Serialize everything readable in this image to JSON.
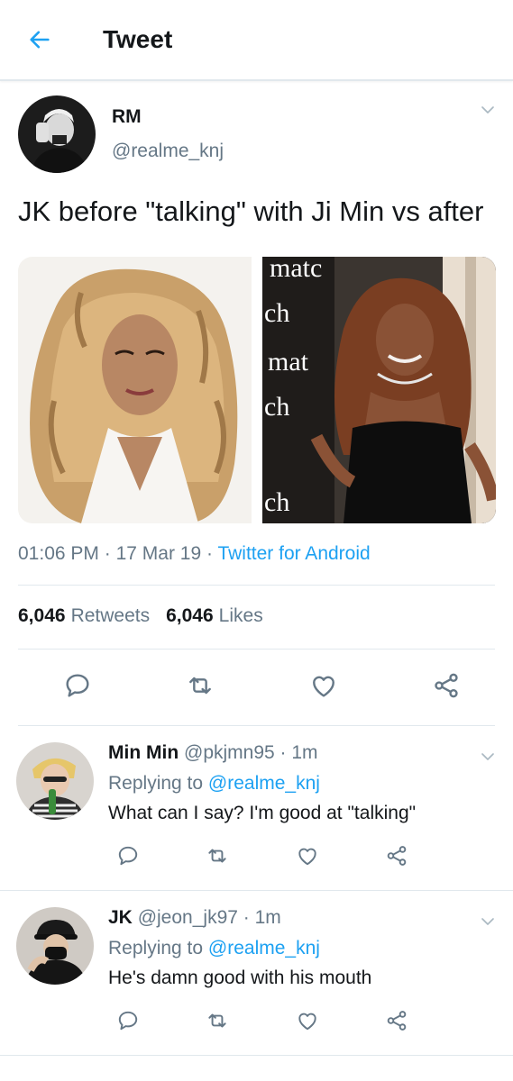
{
  "header": {
    "title": "Tweet"
  },
  "tweet": {
    "author_name": "RM",
    "author_handle": "@realme_knj",
    "text": "JK before \"talking\" with Ji Min vs after",
    "time": "01:06 PM",
    "date": "17 Mar 19",
    "source": "Twitter for Android",
    "sep": "·",
    "retweets_count": "6,046",
    "retweets_label": "Retweets",
    "likes_count": "6,046",
    "likes_label": "Likes",
    "media_texts": [
      "matc",
      "ch",
      "mat",
      "ch",
      "ch"
    ]
  },
  "replies": [
    {
      "name": "Min Min",
      "handle": "@pkjmn95",
      "time": "· 1m",
      "replying_prefix": "Replying to",
      "mention": "@realme_knj",
      "text": "What can I say? I'm good at \"talking\""
    },
    {
      "name": "JK",
      "handle": "@jeon_jk97",
      "time": "· 1m",
      "replying_prefix": "Replying to",
      "mention": "@realme_knj",
      "text": "He's damn good with his mouth"
    }
  ],
  "icons": {
    "back": "arrow-left-icon",
    "caret": "chevron-down-icon",
    "reply": "reply-icon",
    "retweet": "retweet-icon",
    "like": "heart-icon",
    "share": "share-icon"
  },
  "colors": {
    "accent": "#1da1f2",
    "text": "#14171a",
    "secondary": "#657786",
    "divider": "#e1e8ed"
  }
}
